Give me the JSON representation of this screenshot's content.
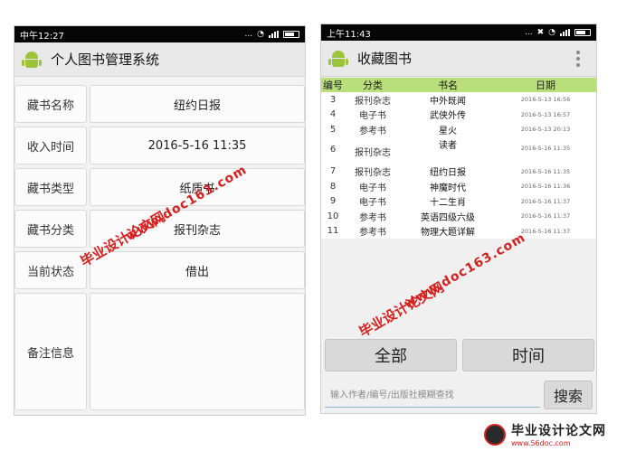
{
  "left": {
    "status_time": "中午12:27",
    "status_dots": "...",
    "title": "个人图书管理系统",
    "fields": [
      {
        "label": "藏书名称",
        "value": "纽约日报"
      },
      {
        "label": "收入时间",
        "value": "2016-5-16 11:35"
      },
      {
        "label": "藏书类型",
        "value": "纸质书"
      },
      {
        "label": "藏书分类",
        "value": "报刊杂志"
      },
      {
        "label": "当前状态",
        "value": "借出"
      },
      {
        "label": "备注信息",
        "value": ""
      }
    ]
  },
  "right": {
    "status_time": "上午11:43",
    "status_dots": "...",
    "title": "收藏图书",
    "columns": [
      "编号",
      "分类",
      "书名",
      "日期"
    ],
    "rows": [
      {
        "no": "3",
        "cat": "报刊杂志",
        "name": "中外既闻",
        "date": "2016-5-13 16:56"
      },
      {
        "no": "4",
        "cat": "电子书",
        "name": "武侠外传",
        "date": "2016-5-13 16:57"
      },
      {
        "no": "5",
        "cat": "参考书",
        "name": "星火",
        "date": "2016-5-13 20:13"
      },
      {
        "no": "6",
        "cat": "报刊杂志",
        "name": "读者",
        "date": "2016-5-16 11:35"
      },
      {
        "no": "7",
        "cat": "报刊杂志",
        "name": "纽约日报",
        "date": "2016-5-16 11:35"
      },
      {
        "no": "8",
        "cat": "电子书",
        "name": "神魔时代",
        "date": "2016-5-16 11:36"
      },
      {
        "no": "9",
        "cat": "电子书",
        "name": "十二生肖",
        "date": "2016-5-16 11:37"
      },
      {
        "no": "10",
        "cat": "参考书",
        "name": "英语四级六级",
        "date": "2016-5-16 11:37"
      },
      {
        "no": "11",
        "cat": "参考书",
        "name": "物理大题详解",
        "date": "2016-5-16 11:37"
      }
    ],
    "btn_all": "全部",
    "btn_time": "时间",
    "search_placeholder": "输入作者/编号/出版社模糊查找",
    "search_button": "搜索"
  },
  "watermark": {
    "site_name": "毕业设计论文网",
    "url": "www.doc163.com",
    "footer_name": "毕业设计论文网",
    "footer_url": "www.56doc.com"
  },
  "colors": {
    "table_header": "#b9df7a",
    "watermark": "#d32020",
    "android_green": "#9bc43a"
  }
}
